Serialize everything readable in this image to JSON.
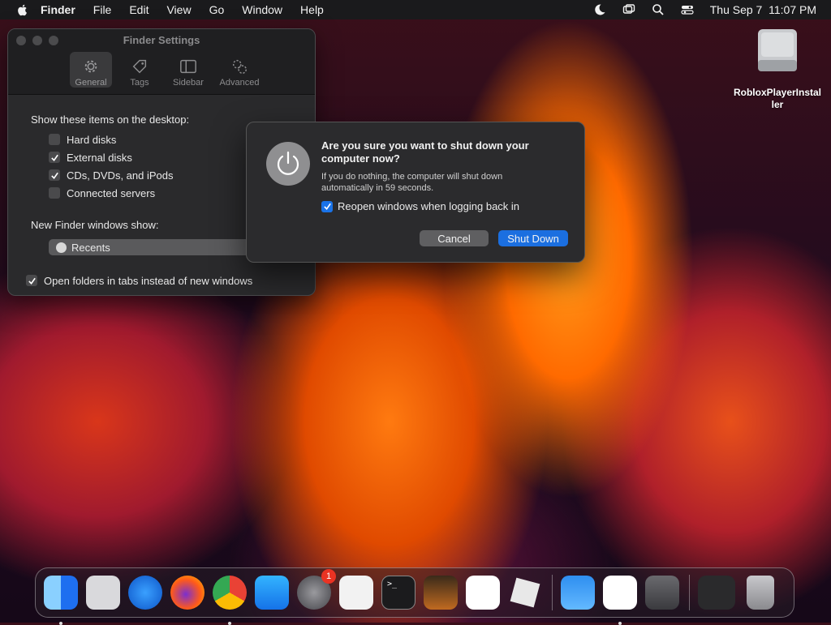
{
  "menubar": {
    "app": "Finder",
    "items": [
      "File",
      "Edit",
      "View",
      "Go",
      "Window",
      "Help"
    ],
    "datetime": "Thu Sep 7  11:07 PM"
  },
  "finder_settings": {
    "title": "Finder Settings",
    "tabs": [
      {
        "label": "General",
        "icon": "gear-icon",
        "active": true
      },
      {
        "label": "Tags",
        "icon": "tag-icon"
      },
      {
        "label": "Sidebar",
        "icon": "sidebar-icon"
      },
      {
        "label": "Advanced",
        "icon": "gears-icon"
      }
    ],
    "desktop_heading": "Show these items on the desktop:",
    "desktop_items": [
      {
        "label": "Hard disks",
        "checked": false
      },
      {
        "label": "External disks",
        "checked": true
      },
      {
        "label": "CDs, DVDs, and iPods",
        "checked": true
      },
      {
        "label": "Connected servers",
        "checked": false
      }
    ],
    "new_window_heading": "New Finder windows show:",
    "new_window_value": "Recents",
    "tabs_option": {
      "label": "Open folders in tabs instead of new windows",
      "checked": true
    }
  },
  "shutdown_dialog": {
    "heading": "Are you sure you want to shut down your computer now?",
    "message": "If you do nothing, the computer will shut down automatically in 59 seconds.",
    "reopen_label": "Reopen windows when logging back in",
    "reopen_checked": true,
    "cancel_label": "Cancel",
    "ok_label": "Shut Down"
  },
  "desktop_icon": {
    "label": "RobloxPlayerInstal ler"
  },
  "dock": {
    "apps": [
      "Finder",
      "Launchpad",
      "Safari",
      "Firefox",
      "Chrome",
      "App Store",
      "System Settings",
      "TextEdit",
      "Terminal",
      "GarageBand",
      "Visual Studio Code",
      "Roblox",
      "Weather",
      "Freeform",
      "Keychain Access",
      "Finder Window",
      "Trash"
    ],
    "settings_badge": "1"
  }
}
